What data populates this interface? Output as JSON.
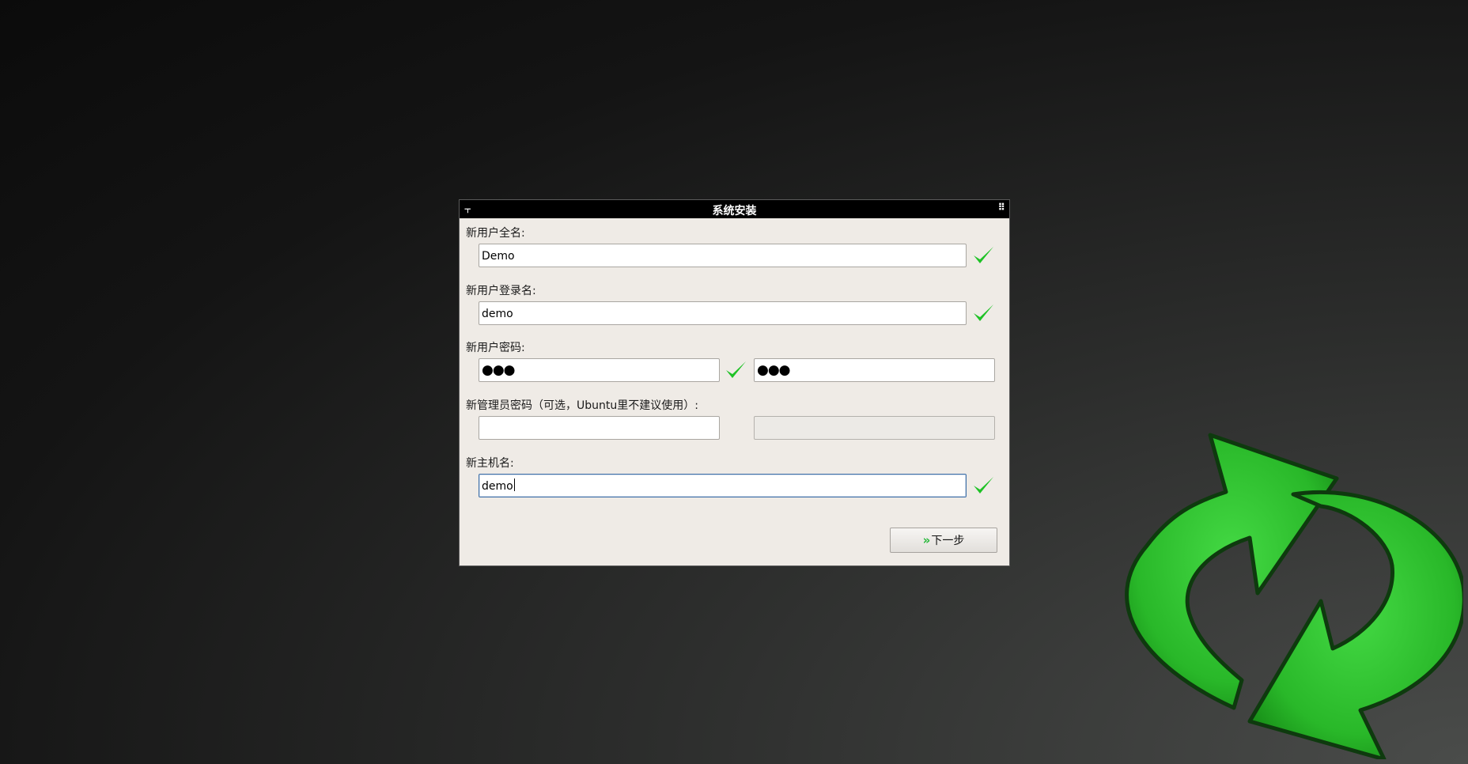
{
  "window": {
    "title": "系统安装",
    "pin_icon": "⫟",
    "menu_icon": "⠿"
  },
  "form": {
    "full_name": {
      "label": "新用户全名:",
      "value": "Demo",
      "valid": true
    },
    "login_name": {
      "label": "新用户登录名:",
      "value": "demo",
      "valid": true
    },
    "password": {
      "label": "新用户密码:",
      "value_masked": "●●●",
      "confirm_masked": "●●●",
      "valid": true
    },
    "admin_password": {
      "label": "新管理员密码（可选，Ubuntu里不建议使用）:",
      "value": "",
      "confirm": ""
    },
    "hostname": {
      "label": "新主机名:",
      "value": "demo",
      "valid": true
    }
  },
  "buttons": {
    "next_arrows": "»",
    "next_label": "下一步"
  },
  "colors": {
    "check": "#1fc226",
    "logo_green": "#2fbf2f",
    "titlebar": "#000000",
    "dialog_bg": "#efebe6"
  },
  "icons": {
    "check": "checkmark-icon",
    "logo": "refresh-cycle-icon"
  }
}
